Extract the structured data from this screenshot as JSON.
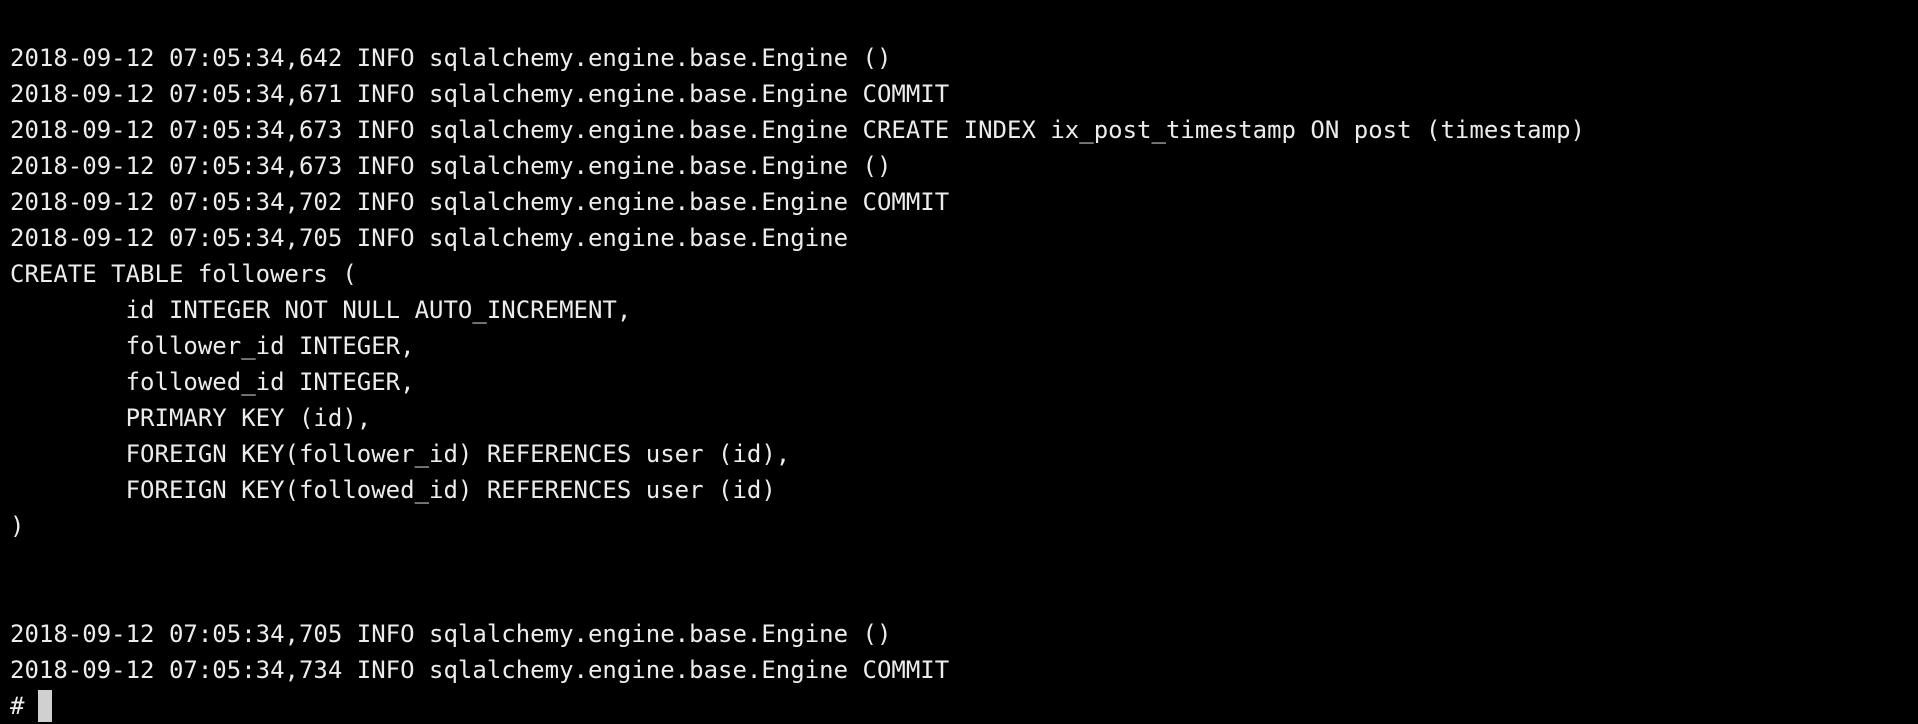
{
  "terminal": {
    "lines": [
      "2018-09-12 07:05:34,642 INFO sqlalchemy.engine.base.Engine ()",
      "2018-09-12 07:05:34,671 INFO sqlalchemy.engine.base.Engine COMMIT",
      "2018-09-12 07:05:34,673 INFO sqlalchemy.engine.base.Engine CREATE INDEX ix_post_timestamp ON post (timestamp)",
      "2018-09-12 07:05:34,673 INFO sqlalchemy.engine.base.Engine ()",
      "2018-09-12 07:05:34,702 INFO sqlalchemy.engine.base.Engine COMMIT",
      "2018-09-12 07:05:34,705 INFO sqlalchemy.engine.base.Engine",
      "CREATE TABLE followers (",
      "        id INTEGER NOT NULL AUTO_INCREMENT,",
      "        follower_id INTEGER,",
      "        followed_id INTEGER,",
      "        PRIMARY KEY (id),",
      "        FOREIGN KEY(follower_id) REFERENCES user (id),",
      "        FOREIGN KEY(followed_id) REFERENCES user (id)",
      ")",
      "",
      "",
      "2018-09-12 07:05:34,705 INFO sqlalchemy.engine.base.Engine ()",
      "2018-09-12 07:05:34,734 INFO sqlalchemy.engine.base.Engine COMMIT"
    ],
    "prompt": "#"
  },
  "colors": {
    "background": "#000000",
    "foreground": "#ececec",
    "cursor": "#d0d0d0"
  }
}
